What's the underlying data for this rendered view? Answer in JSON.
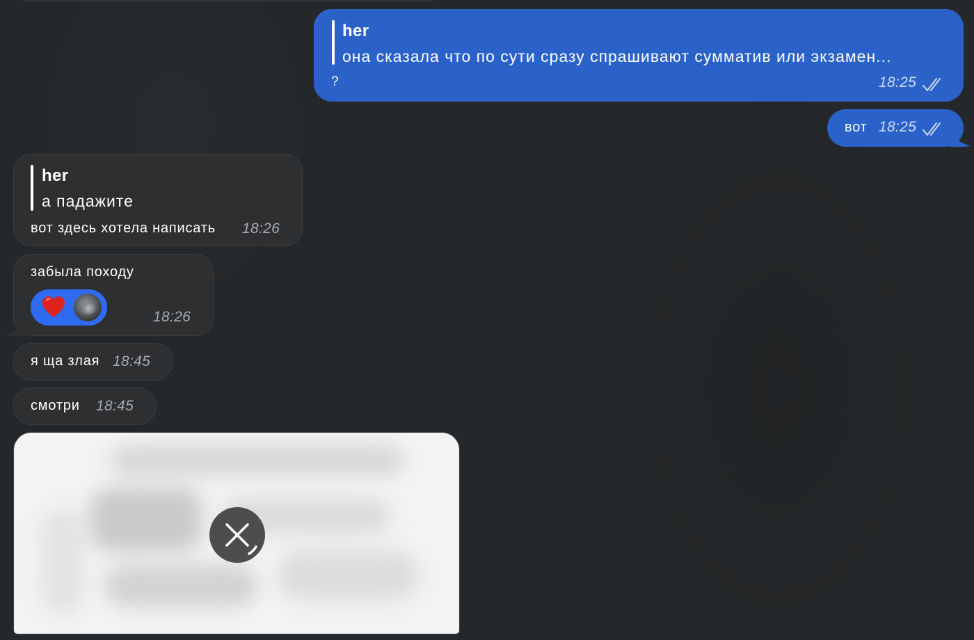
{
  "messages": {
    "m1": {
      "reply_author": "her",
      "reply_text": "она сказала что по сути сразу спрашивают сумматив или экзамен...",
      "text": "?",
      "time": "18:25",
      "status_icon": "double-check-icon"
    },
    "m2": {
      "text": "вот",
      "time": "18:25",
      "status_icon": "double-check-icon"
    },
    "m3": {
      "reply_author": "her",
      "reply_text": "а падажите",
      "text": "вот здесь хотела написать",
      "time": "18:26"
    },
    "m4": {
      "text": "забыла походу",
      "time": "18:26",
      "reaction": {
        "emoji": "♥",
        "icon": "heart-icon",
        "avatar": "avatar"
      }
    },
    "m5": {
      "text": "я ща злая",
      "time": "18:45"
    },
    "m6": {
      "text": "смотри",
      "time": "18:45"
    },
    "m7": {
      "type": "image",
      "icon": "cancel-download-icon"
    }
  },
  "colors": {
    "background": "#25282a",
    "outgoing_bubble": "#2a62c9",
    "incoming_bubble": "#2e2f30",
    "reaction_pill": "#2f6bf0",
    "heart": "#e0241c"
  }
}
